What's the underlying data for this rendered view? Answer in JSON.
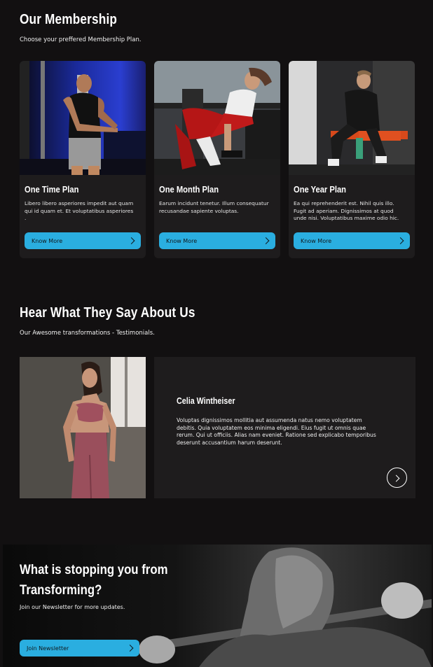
{
  "membership": {
    "title": "Our Membership",
    "subtitle": "Choose your preffered Membership Plan.",
    "plans": [
      {
        "title": "One Time Plan",
        "description": "Libero libero asperiores impedit aut quam qui id quam et. Et voluptatibus asperiores .",
        "button": "Know More"
      },
      {
        "title": "One Month Plan",
        "description": "Earum incidunt tenetur. Illum consequatur recusandae sapiente voluptas.",
        "button": "Know More"
      },
      {
        "title": "One Year Plan",
        "description": "Ea qui reprehenderit est. Nihil quis illo. Fugit ad aperiam. Dignissimos at quod unde nisi. Voluptatibus maxime odio hic.",
        "button": "Know More"
      }
    ]
  },
  "testimonials": {
    "title": "Hear What They Say About Us",
    "subtitle": "Our Awesome transformations - Testimonials.",
    "name": "Celia Wintheiser",
    "quote": "Voluptas dignissimos mollitia aut assumenda natus nemo voluptatem debitis. Quia voluptatem eos minima eligendi. Eius fugit ut omnis quae rerum. Qui ut officiis. Alias nam eveniet. Ratione sed explicabo temporibus deserunt accusantium harum deserunt."
  },
  "newsletter": {
    "title": "What is stopping you from Transforming?",
    "subtitle": "Join our Newsletter for more updates.",
    "button": "Join Newsletter"
  },
  "colors": {
    "background": "#121011",
    "card": "#1e1c1d",
    "accent": "#2aaee0"
  },
  "icons": {
    "button_arrow": "chevron-right-icon",
    "carousel_next": "chevron-right-icon"
  }
}
